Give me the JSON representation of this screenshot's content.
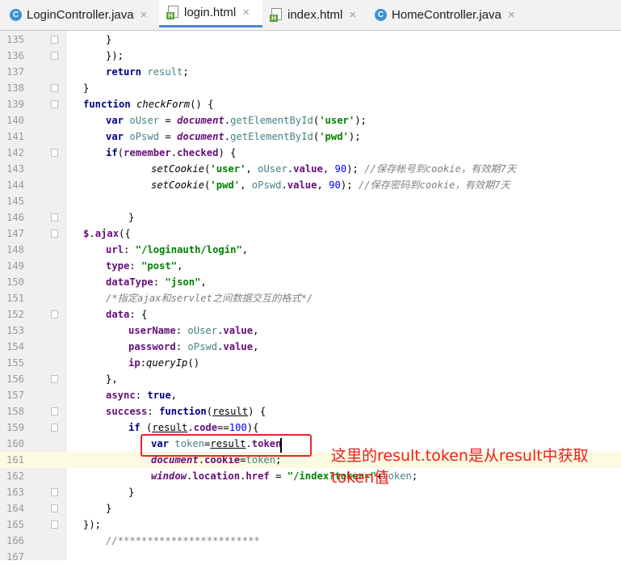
{
  "tabs": [
    {
      "label": "LoginController.java",
      "icon": "class-icon"
    },
    {
      "label": "login.html",
      "icon": "html-file-icon",
      "active": true
    },
    {
      "label": "index.html",
      "icon": "html-file-icon"
    },
    {
      "label": "HomeController.java",
      "icon": "class-icon"
    }
  ],
  "tab_close_glyph": "×",
  "class_icon_glyph": "C",
  "html_icon_glyph": "H",
  "line_numbers": [
    "135",
    "136",
    "137",
    "138",
    "139",
    "140",
    "141",
    "142",
    "143",
    "144",
    "145",
    "146",
    "147",
    "148",
    "149",
    "150",
    "151",
    "152",
    "153",
    "154",
    "155",
    "156",
    "157",
    "158",
    "159",
    "160",
    "161",
    "162",
    "163",
    "164",
    "165",
    "166",
    "167"
  ],
  "code_lines": [
    [
      [
        "p",
        "}"
      ]
    ],
    [
      [
        "p",
        "});"
      ]
    ],
    [
      [
        "kw",
        "return "
      ],
      [
        "vr",
        "result"
      ],
      [
        "p",
        ";"
      ]
    ],
    [
      [
        "p",
        "}"
      ]
    ],
    [
      [
        "kw",
        "function "
      ],
      [
        "fn",
        "checkForm"
      ],
      [
        "p",
        "() {"
      ]
    ],
    [
      [
        "kw",
        "var "
      ],
      [
        "vr",
        "oUser"
      ],
      [
        "p",
        " = "
      ],
      [
        "gl",
        "document"
      ],
      [
        "p",
        "."
      ],
      [
        "vr",
        "getElementById"
      ],
      [
        "p",
        "("
      ],
      [
        "st",
        "'user'"
      ],
      [
        "p",
        ");"
      ]
    ],
    [
      [
        "kw",
        "var "
      ],
      [
        "vr",
        "oPswd"
      ],
      [
        "p",
        " = "
      ],
      [
        "gl",
        "document"
      ],
      [
        "p",
        "."
      ],
      [
        "vr",
        "getElementById"
      ],
      [
        "p",
        "("
      ],
      [
        "st",
        "'pwd'"
      ],
      [
        "p",
        ");"
      ]
    ],
    [
      [
        "kw",
        "if"
      ],
      [
        "p",
        "("
      ],
      [
        "pr",
        "remember"
      ],
      [
        "p",
        "."
      ],
      [
        "pr",
        "checked"
      ],
      [
        "p",
        ") {"
      ]
    ],
    [
      [
        "fn",
        "setCookie"
      ],
      [
        "p",
        "("
      ],
      [
        "st",
        "'user'"
      ],
      [
        "p",
        ", "
      ],
      [
        "vr",
        "oUser"
      ],
      [
        "p",
        "."
      ],
      [
        "pr",
        "value"
      ],
      [
        "p",
        ", "
      ],
      [
        "nm",
        "90"
      ],
      [
        "p",
        "); "
      ],
      [
        "cm",
        "//保存帐号到cookie，有效期7天"
      ]
    ],
    [
      [
        "fn",
        "setCookie"
      ],
      [
        "p",
        "("
      ],
      [
        "st",
        "'pwd'"
      ],
      [
        "p",
        ", "
      ],
      [
        "vr",
        "oPswd"
      ],
      [
        "p",
        "."
      ],
      [
        "pr",
        "value"
      ],
      [
        "p",
        ", "
      ],
      [
        "nm",
        "90"
      ],
      [
        "p",
        "); "
      ],
      [
        "cm",
        "//保存密码到cookie，有效期7天"
      ]
    ],
    [],
    [
      [
        "p",
        "}"
      ]
    ],
    [
      [
        "pr",
        "$"
      ],
      [
        "p",
        "."
      ],
      [
        "pr",
        "ajax"
      ],
      [
        "p",
        "({"
      ]
    ],
    [
      [
        "pr",
        "url"
      ],
      [
        "p",
        ": "
      ],
      [
        "st",
        "\"/loginauth/login\""
      ],
      [
        "p",
        ","
      ]
    ],
    [
      [
        "pr",
        "type"
      ],
      [
        "p",
        ": "
      ],
      [
        "st",
        "\"post\""
      ],
      [
        "p",
        ","
      ]
    ],
    [
      [
        "pr",
        "dataType"
      ],
      [
        "p",
        ": "
      ],
      [
        "st",
        "\"json\""
      ],
      [
        "p",
        ","
      ]
    ],
    [
      [
        "cm",
        "/*指定ajax和servlet之间数据交互的格式*/"
      ]
    ],
    [
      [
        "pr",
        "data"
      ],
      [
        "p",
        ": {"
      ]
    ],
    [
      [
        "pr",
        "userName"
      ],
      [
        "p",
        ": "
      ],
      [
        "vr",
        "oUser"
      ],
      [
        "p",
        "."
      ],
      [
        "pr",
        "value"
      ],
      [
        "p",
        ","
      ]
    ],
    [
      [
        "pr",
        "password"
      ],
      [
        "p",
        ": "
      ],
      [
        "vr",
        "oPswd"
      ],
      [
        "p",
        "."
      ],
      [
        "pr",
        "value"
      ],
      [
        "p",
        ","
      ]
    ],
    [
      [
        "pr",
        "ip"
      ],
      [
        "p",
        ":"
      ],
      [
        "fn",
        "queryIp"
      ],
      [
        "p",
        "()"
      ]
    ],
    [
      [
        "p",
        "},"
      ]
    ],
    [
      [
        "pr",
        "async"
      ],
      [
        "p",
        ": "
      ],
      [
        "kw",
        "true"
      ],
      [
        "p",
        ","
      ]
    ],
    [
      [
        "pr",
        "success"
      ],
      [
        "p",
        ": "
      ],
      [
        "kw",
        "function"
      ],
      [
        "p",
        "("
      ],
      [
        "ul",
        "result"
      ],
      [
        "p",
        ") {"
      ]
    ],
    [
      [
        "kw",
        "if "
      ],
      [
        "p",
        "("
      ],
      [
        "ul",
        "result"
      ],
      [
        "p",
        "."
      ],
      [
        "pr",
        "code"
      ],
      [
        "p",
        "=="
      ],
      [
        "nm",
        "100"
      ],
      [
        "p",
        "){"
      ]
    ],
    [
      [
        "kw",
        "var "
      ],
      [
        "vr",
        "token"
      ],
      [
        "p",
        "="
      ],
      [
        "ul",
        "result"
      ],
      [
        "p",
        "."
      ],
      [
        "pr",
        "token"
      ]
    ],
    [
      [
        "gl",
        "document"
      ],
      [
        "p",
        "."
      ],
      [
        "pr",
        "cookie"
      ],
      [
        "p",
        "="
      ],
      [
        "vr",
        "token"
      ],
      [
        "p",
        ";"
      ]
    ],
    [
      [
        "gl",
        "window"
      ],
      [
        "p",
        "."
      ],
      [
        "pr",
        "location"
      ],
      [
        "p",
        "."
      ],
      [
        "pr",
        "href"
      ],
      [
        "p",
        " = "
      ],
      [
        "st",
        "\"/index?token=\""
      ],
      [
        "p",
        "+"
      ],
      [
        "vr",
        "token"
      ],
      [
        "p",
        ";"
      ]
    ],
    [
      [
        "p",
        "}"
      ]
    ],
    [
      [
        "p",
        "}"
      ]
    ],
    [
      [
        "p",
        "});"
      ]
    ],
    [
      [
        "cm",
        "//************************"
      ]
    ],
    []
  ],
  "annotation": "这里的result.token是从result中获取token值",
  "colors": {
    "keyword": "#000080",
    "string": "#008000",
    "number": "#0000ff",
    "comment": "#808080",
    "variable": "#458383",
    "property": "#660e7a",
    "highlight": "#fcfae1",
    "annotation": "#f01c1c"
  }
}
